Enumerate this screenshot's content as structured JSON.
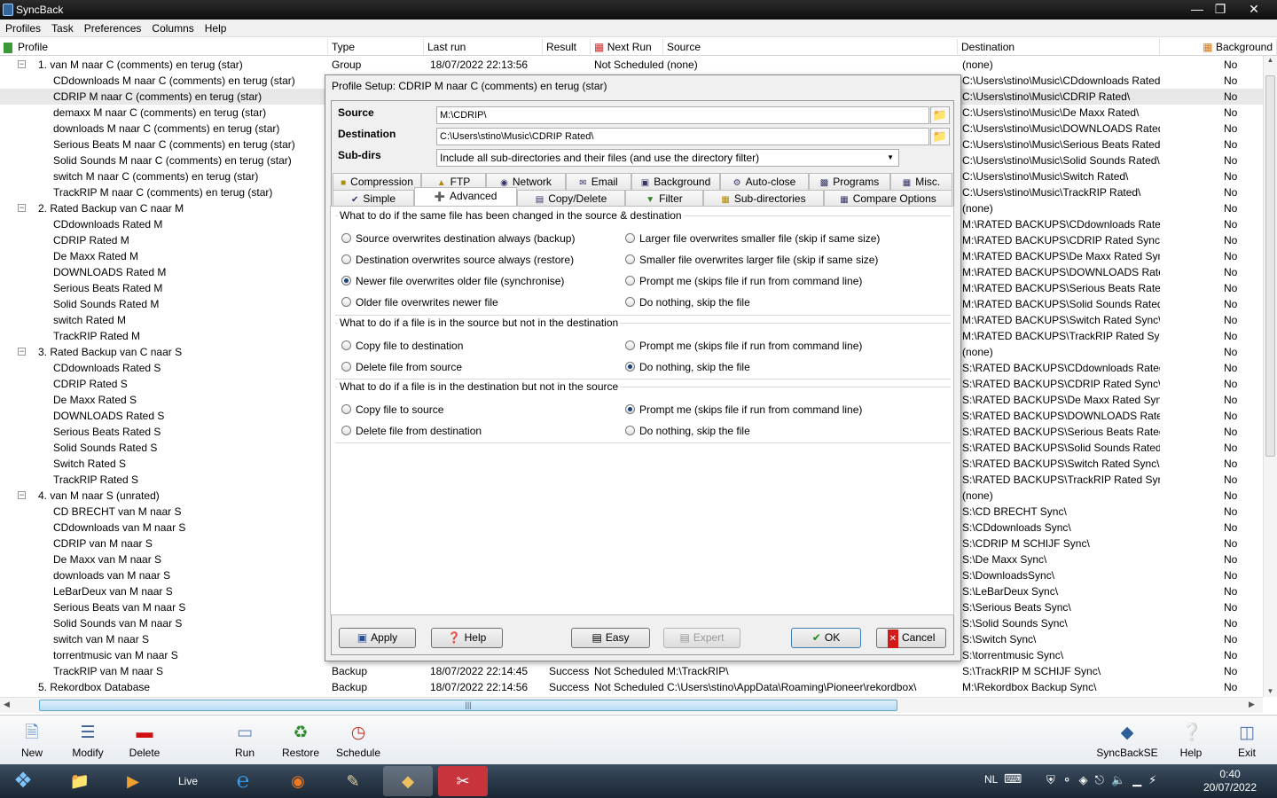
{
  "window": {
    "title": "SyncBack"
  },
  "menu": [
    "Profiles",
    "Task",
    "Preferences",
    "Columns",
    "Help"
  ],
  "columns": [
    "Profile",
    "Type",
    "Last run",
    "Result",
    "Next Run",
    "Source",
    "Destination",
    "Background"
  ],
  "rows": [
    {
      "level": 0,
      "expander": "−",
      "name": "1. van M naar C (comments) en terug (star)",
      "type": "Group",
      "lastrun": "18/07/2022 22:13:56",
      "result": "",
      "nextrun": "Not Scheduled",
      "source": "(none)",
      "dest": "(none)",
      "bg": "No"
    },
    {
      "level": 1,
      "name": "CDdownloads M naar C (comments) en terug (star)",
      "dest": "C:\\Users\\stino\\Music\\CDdownloads Rated\\",
      "bg": "No"
    },
    {
      "level": 1,
      "name": "CDRIP M naar C (comments) en terug (star)",
      "dest": "C:\\Users\\stino\\Music\\CDRIP Rated\\",
      "bg": "No",
      "selected": true
    },
    {
      "level": 1,
      "name": "demaxx M naar C (comments) en terug (star)",
      "dest": "C:\\Users\\stino\\Music\\De Maxx Rated\\",
      "bg": "No"
    },
    {
      "level": 1,
      "name": "downloads M naar C (comments) en terug (star)",
      "dest": "C:\\Users\\stino\\Music\\DOWNLOADS Rated\\",
      "bg": "No"
    },
    {
      "level": 1,
      "name": "Serious Beats M naar C (comments) en terug (star)",
      "dest": "C:\\Users\\stino\\Music\\Serious Beats Rated\\",
      "bg": "No"
    },
    {
      "level": 1,
      "name": "Solid Sounds M naar C (comments) en terug (star)",
      "dest": "C:\\Users\\stino\\Music\\Solid Sounds Rated\\",
      "bg": "No"
    },
    {
      "level": 1,
      "name": "switch M naar C (comments) en terug (star)",
      "dest": "C:\\Users\\stino\\Music\\Switch Rated\\",
      "bg": "No"
    },
    {
      "level": 1,
      "name": "TrackRIP M naar C (comments) en terug (star)",
      "dest": "C:\\Users\\stino\\Music\\TrackRIP Rated\\",
      "bg": "No"
    },
    {
      "level": 0,
      "expander": "−",
      "name": "2. Rated Backup van C naar M",
      "dest": "(none)",
      "bg": "No"
    },
    {
      "level": 1,
      "name": "CDdownloads Rated M",
      "dest": "M:\\RATED BACKUPS\\CDdownloads Rated ...",
      "bg": "No"
    },
    {
      "level": 1,
      "name": "CDRIP Rated M",
      "dest": "M:\\RATED BACKUPS\\CDRIP Rated Sync\\",
      "bg": "No"
    },
    {
      "level": 1,
      "name": "De Maxx Rated M",
      "dest": "M:\\RATED BACKUPS\\De Maxx Rated Sync\\",
      "bg": "No"
    },
    {
      "level": 1,
      "name": "DOWNLOADS Rated M",
      "dest": "M:\\RATED BACKUPS\\DOWNLOADS Rated ...",
      "bg": "No"
    },
    {
      "level": 1,
      "name": "Serious Beats Rated M",
      "dest": "M:\\RATED BACKUPS\\Serious Beats Rated ...",
      "bg": "No"
    },
    {
      "level": 1,
      "name": "Solid Sounds Rated M",
      "dest": "M:\\RATED BACKUPS\\Solid Sounds Rated S...",
      "bg": "No"
    },
    {
      "level": 1,
      "name": "switch Rated M",
      "dest": "M:\\RATED BACKUPS\\Switch Rated Sync\\",
      "bg": "No"
    },
    {
      "level": 1,
      "name": "TrackRIP Rated M",
      "dest": "M:\\RATED BACKUPS\\TrackRIP Rated Sync\\",
      "bg": "No"
    },
    {
      "level": 0,
      "expander": "−",
      "name": "3. Rated Backup van C naar S",
      "dest": "(none)",
      "bg": "No"
    },
    {
      "level": 1,
      "name": "CDdownloads Rated S",
      "dest": "S:\\RATED BACKUPS\\CDdownloads Rated S...",
      "bg": "No"
    },
    {
      "level": 1,
      "name": "CDRIP Rated S",
      "dest": "S:\\RATED BACKUPS\\CDRIP Rated Sync\\",
      "bg": "No"
    },
    {
      "level": 1,
      "name": "De Maxx Rated S",
      "dest": "S:\\RATED BACKUPS\\De Maxx Rated Sync\\",
      "bg": "No"
    },
    {
      "level": 1,
      "name": "DOWNLOADS Rated S",
      "dest": "S:\\RATED BACKUPS\\DOWNLOADS Rated S...",
      "bg": "No"
    },
    {
      "level": 1,
      "name": "Serious Beats Rated S",
      "dest": "S:\\RATED BACKUPS\\Serious Beats Rated S...",
      "bg": "No"
    },
    {
      "level": 1,
      "name": "Solid Sounds Rated S",
      "dest": "S:\\RATED BACKUPS\\Solid Sounds Rated Sy...",
      "bg": "No"
    },
    {
      "level": 1,
      "name": "Switch Rated S",
      "dest": "S:\\RATED BACKUPS\\Switch Rated Sync\\",
      "bg": "No"
    },
    {
      "level": 1,
      "name": "TrackRIP Rated S",
      "dest": "S:\\RATED BACKUPS\\TrackRIP Rated Sync\\",
      "bg": "No"
    },
    {
      "level": 0,
      "expander": "−",
      "name": "4. van M naar S (unrated)",
      "dest": "(none)",
      "bg": "No"
    },
    {
      "level": 1,
      "name": "CD BRECHT van M naar S",
      "dest": "S:\\CD BRECHT Sync\\",
      "bg": "No"
    },
    {
      "level": 1,
      "name": "CDdownloads van M naar S",
      "dest": "S:\\CDdownloads Sync\\",
      "bg": "No"
    },
    {
      "level": 1,
      "name": "CDRIP van M naar  S",
      "dest": "S:\\CDRIP M SCHIJF Sync\\",
      "bg": "No"
    },
    {
      "level": 1,
      "name": "De Maxx van M naar S",
      "dest": "S:\\De Maxx Sync\\",
      "bg": "No"
    },
    {
      "level": 1,
      "name": "downloads van M naar S",
      "dest": "S:\\DownloadsSync\\",
      "bg": "No"
    },
    {
      "level": 1,
      "name": "LeBarDeux van M naar S",
      "dest": "S:\\LeBarDeux Sync\\",
      "bg": "No"
    },
    {
      "level": 1,
      "name": "Serious Beats van M naar S",
      "dest": "S:\\Serious Beats Sync\\",
      "bg": "No"
    },
    {
      "level": 1,
      "name": "Solid Sounds van M naar S",
      "dest": "S:\\Solid Sounds Sync\\",
      "bg": "No"
    },
    {
      "level": 1,
      "name": "switch van M naar S",
      "dest": "S:\\Switch Sync\\",
      "bg": "No"
    },
    {
      "level": 1,
      "name": "torrentmusic van M naar S",
      "dest": "S:\\torrentmusic Sync\\",
      "bg": "No"
    },
    {
      "level": 1,
      "name": "TrackRIP van M naar  S",
      "type": "Backup",
      "lastrun": "18/07/2022 22:14:45",
      "result": "Success",
      "nextrun": "Not Scheduled",
      "source": "M:\\TrackRIP\\",
      "dest": "S:\\TrackRIP M SCHIJF Sync\\",
      "bg": "No"
    },
    {
      "level": 0,
      "expander": "",
      "name": "5. Rekordbox Database",
      "type": "Backup",
      "lastrun": "18/07/2022 22:14:56",
      "result": "Success",
      "nextrun": "Not Scheduled",
      "source": "C:\\Users\\stino\\AppData\\Roaming\\Pioneer\\rekordbox\\",
      "dest": "M:\\Rekordbox Backup Sync\\",
      "bg": "No"
    }
  ],
  "dialog": {
    "title": "Profile Setup: CDRIP M naar C (comments) en terug (star)",
    "source_label": "Source",
    "source_value": "M:\\CDRIP\\",
    "dest_label": "Destination",
    "dest_value": "C:\\Users\\stino\\Music\\CDRIP Rated\\",
    "subdirs_label": "Sub-dirs",
    "subdirs_value": "Include all sub-directories and their files (and use the directory filter)",
    "tabs_row1": [
      "Compression",
      "FTP",
      "Network",
      "Email",
      "Background",
      "Auto-close",
      "Programs",
      "Misc."
    ],
    "tabs_row2": [
      "Simple",
      "Advanced",
      "Copy/Delete",
      "Filter",
      "Sub-directories",
      "Compare Options"
    ],
    "group1": {
      "title": "What to do if the same file has been changed in the source & destination",
      "options": [
        "Source overwrites destination always (backup)",
        "Destination overwrites source always (restore)",
        "Newer file overwrites older file (synchronise)",
        "Older file overwrites newer file",
        "Larger file overwrites smaller file (skip if same size)",
        "Smaller file overwrites larger file (skip if same size)",
        "Prompt me (skips file if run from command line)",
        "Do nothing, skip the file"
      ]
    },
    "group2": {
      "title": "What to do if a file is in the source but not in the destination",
      "options": [
        "Copy file to destination",
        "Delete file from source",
        "Prompt me  (skips file if run from command line)",
        "Do nothing, skip the file"
      ]
    },
    "group3": {
      "title": "What to do if a file is in the destination but not in the source",
      "options": [
        "Copy file to source",
        "Delete file from destination",
        "Prompt me  (skips file if run from command line)",
        "Do nothing, skip the file"
      ]
    },
    "buttons": {
      "apply": "Apply",
      "help": "Help",
      "easy": "Easy",
      "expert": "Expert",
      "ok": "OK",
      "cancel": "Cancel"
    }
  },
  "toolbar": [
    "New",
    "Modify",
    "Delete",
    "Run",
    "Restore",
    "Schedule",
    "SyncBackSE",
    "Help",
    "Exit"
  ],
  "taskbar": {
    "live_label": "Live",
    "lang": "NL",
    "time": "0:40",
    "date": "20/07/2022"
  }
}
